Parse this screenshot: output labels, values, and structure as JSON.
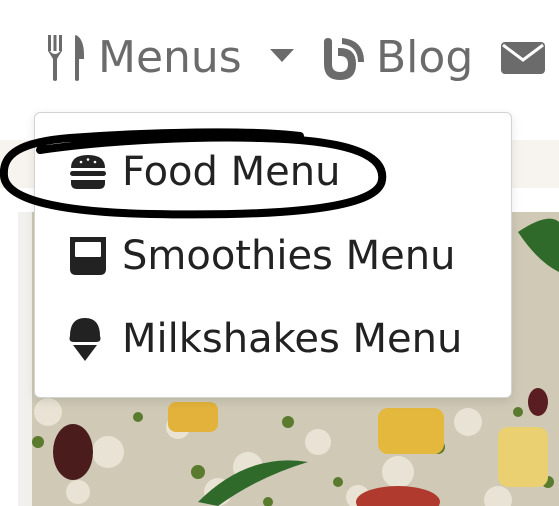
{
  "navbar": {
    "menus": {
      "label": "Menus",
      "icon": "utensils-icon"
    },
    "blog": {
      "label": "Blog",
      "icon": "blogger-icon"
    },
    "mail": {
      "icon": "envelope-icon"
    }
  },
  "dropdown": {
    "items": [
      {
        "label": "Food Menu",
        "icon": "hamburger-icon"
      },
      {
        "label": "Smoothies Menu",
        "icon": "glass-icon"
      },
      {
        "label": "Milkshakes Menu",
        "icon": "ice-cream-icon"
      }
    ]
  },
  "colors": {
    "nav_text": "#6b6b6b",
    "menu_text": "#222222",
    "highlight": "#000000"
  }
}
